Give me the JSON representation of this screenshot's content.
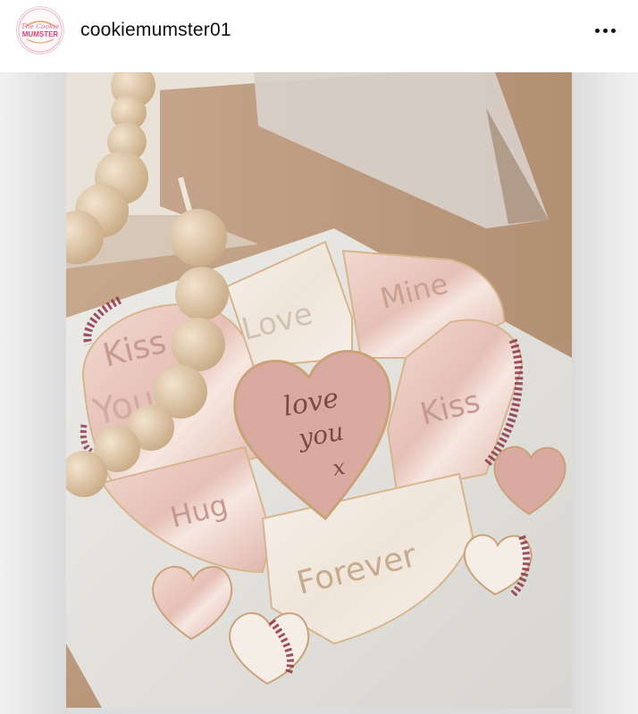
{
  "post": {
    "username": "cookiemumster01",
    "avatar_text_top": "The Cookie",
    "avatar_text_main": "MUMSTER",
    "more_icon": "ellipsis-icon",
    "photo": {
      "cookie_words": {
        "kiss_left": "Kiss",
        "you_left": "You",
        "love": "Love",
        "mine": "Mine",
        "kiss_right": "Kiss",
        "hug": "Hug",
        "forever": "Forever",
        "center_line1": "love",
        "center_line2": "you",
        "center_line3": "x"
      }
    }
  },
  "colors": {
    "box_kraft": "#b8957a",
    "cookie_pink": "#d9a9a0",
    "cookie_cream": "#f2ebe3",
    "petal": "#8e3446",
    "bead_wood": "#d8c0a0"
  }
}
